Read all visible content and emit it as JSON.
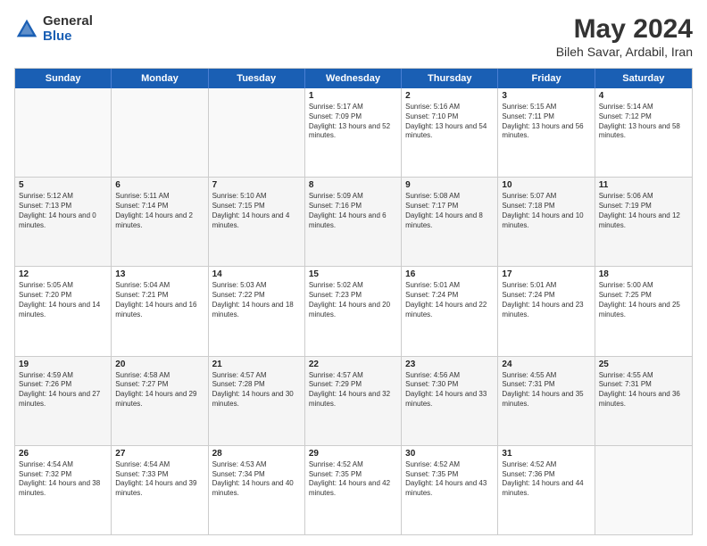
{
  "header": {
    "logo_general": "General",
    "logo_blue": "Blue",
    "title": "May 2024",
    "subtitle": "Bileh Savar, Ardabil, Iran"
  },
  "days_of_week": [
    "Sunday",
    "Monday",
    "Tuesday",
    "Wednesday",
    "Thursday",
    "Friday",
    "Saturday"
  ],
  "weeks": [
    [
      {
        "day": "",
        "sunrise": "",
        "sunset": "",
        "daylight": ""
      },
      {
        "day": "",
        "sunrise": "",
        "sunset": "",
        "daylight": ""
      },
      {
        "day": "",
        "sunrise": "",
        "sunset": "",
        "daylight": ""
      },
      {
        "day": "1",
        "sunrise": "Sunrise: 5:17 AM",
        "sunset": "Sunset: 7:09 PM",
        "daylight": "Daylight: 13 hours and 52 minutes."
      },
      {
        "day": "2",
        "sunrise": "Sunrise: 5:16 AM",
        "sunset": "Sunset: 7:10 PM",
        "daylight": "Daylight: 13 hours and 54 minutes."
      },
      {
        "day": "3",
        "sunrise": "Sunrise: 5:15 AM",
        "sunset": "Sunset: 7:11 PM",
        "daylight": "Daylight: 13 hours and 56 minutes."
      },
      {
        "day": "4",
        "sunrise": "Sunrise: 5:14 AM",
        "sunset": "Sunset: 7:12 PM",
        "daylight": "Daylight: 13 hours and 58 minutes."
      }
    ],
    [
      {
        "day": "5",
        "sunrise": "Sunrise: 5:12 AM",
        "sunset": "Sunset: 7:13 PM",
        "daylight": "Daylight: 14 hours and 0 minutes."
      },
      {
        "day": "6",
        "sunrise": "Sunrise: 5:11 AM",
        "sunset": "Sunset: 7:14 PM",
        "daylight": "Daylight: 14 hours and 2 minutes."
      },
      {
        "day": "7",
        "sunrise": "Sunrise: 5:10 AM",
        "sunset": "Sunset: 7:15 PM",
        "daylight": "Daylight: 14 hours and 4 minutes."
      },
      {
        "day": "8",
        "sunrise": "Sunrise: 5:09 AM",
        "sunset": "Sunset: 7:16 PM",
        "daylight": "Daylight: 14 hours and 6 minutes."
      },
      {
        "day": "9",
        "sunrise": "Sunrise: 5:08 AM",
        "sunset": "Sunset: 7:17 PM",
        "daylight": "Daylight: 14 hours and 8 minutes."
      },
      {
        "day": "10",
        "sunrise": "Sunrise: 5:07 AM",
        "sunset": "Sunset: 7:18 PM",
        "daylight": "Daylight: 14 hours and 10 minutes."
      },
      {
        "day": "11",
        "sunrise": "Sunrise: 5:06 AM",
        "sunset": "Sunset: 7:19 PM",
        "daylight": "Daylight: 14 hours and 12 minutes."
      }
    ],
    [
      {
        "day": "12",
        "sunrise": "Sunrise: 5:05 AM",
        "sunset": "Sunset: 7:20 PM",
        "daylight": "Daylight: 14 hours and 14 minutes."
      },
      {
        "day": "13",
        "sunrise": "Sunrise: 5:04 AM",
        "sunset": "Sunset: 7:21 PM",
        "daylight": "Daylight: 14 hours and 16 minutes."
      },
      {
        "day": "14",
        "sunrise": "Sunrise: 5:03 AM",
        "sunset": "Sunset: 7:22 PM",
        "daylight": "Daylight: 14 hours and 18 minutes."
      },
      {
        "day": "15",
        "sunrise": "Sunrise: 5:02 AM",
        "sunset": "Sunset: 7:23 PM",
        "daylight": "Daylight: 14 hours and 20 minutes."
      },
      {
        "day": "16",
        "sunrise": "Sunrise: 5:01 AM",
        "sunset": "Sunset: 7:24 PM",
        "daylight": "Daylight: 14 hours and 22 minutes."
      },
      {
        "day": "17",
        "sunrise": "Sunrise: 5:01 AM",
        "sunset": "Sunset: 7:24 PM",
        "daylight": "Daylight: 14 hours and 23 minutes."
      },
      {
        "day": "18",
        "sunrise": "Sunrise: 5:00 AM",
        "sunset": "Sunset: 7:25 PM",
        "daylight": "Daylight: 14 hours and 25 minutes."
      }
    ],
    [
      {
        "day": "19",
        "sunrise": "Sunrise: 4:59 AM",
        "sunset": "Sunset: 7:26 PM",
        "daylight": "Daylight: 14 hours and 27 minutes."
      },
      {
        "day": "20",
        "sunrise": "Sunrise: 4:58 AM",
        "sunset": "Sunset: 7:27 PM",
        "daylight": "Daylight: 14 hours and 29 minutes."
      },
      {
        "day": "21",
        "sunrise": "Sunrise: 4:57 AM",
        "sunset": "Sunset: 7:28 PM",
        "daylight": "Daylight: 14 hours and 30 minutes."
      },
      {
        "day": "22",
        "sunrise": "Sunrise: 4:57 AM",
        "sunset": "Sunset: 7:29 PM",
        "daylight": "Daylight: 14 hours and 32 minutes."
      },
      {
        "day": "23",
        "sunrise": "Sunrise: 4:56 AM",
        "sunset": "Sunset: 7:30 PM",
        "daylight": "Daylight: 14 hours and 33 minutes."
      },
      {
        "day": "24",
        "sunrise": "Sunrise: 4:55 AM",
        "sunset": "Sunset: 7:31 PM",
        "daylight": "Daylight: 14 hours and 35 minutes."
      },
      {
        "day": "25",
        "sunrise": "Sunrise: 4:55 AM",
        "sunset": "Sunset: 7:31 PM",
        "daylight": "Daylight: 14 hours and 36 minutes."
      }
    ],
    [
      {
        "day": "26",
        "sunrise": "Sunrise: 4:54 AM",
        "sunset": "Sunset: 7:32 PM",
        "daylight": "Daylight: 14 hours and 38 minutes."
      },
      {
        "day": "27",
        "sunrise": "Sunrise: 4:54 AM",
        "sunset": "Sunset: 7:33 PM",
        "daylight": "Daylight: 14 hours and 39 minutes."
      },
      {
        "day": "28",
        "sunrise": "Sunrise: 4:53 AM",
        "sunset": "Sunset: 7:34 PM",
        "daylight": "Daylight: 14 hours and 40 minutes."
      },
      {
        "day": "29",
        "sunrise": "Sunrise: 4:52 AM",
        "sunset": "Sunset: 7:35 PM",
        "daylight": "Daylight: 14 hours and 42 minutes."
      },
      {
        "day": "30",
        "sunrise": "Sunrise: 4:52 AM",
        "sunset": "Sunset: 7:35 PM",
        "daylight": "Daylight: 14 hours and 43 minutes."
      },
      {
        "day": "31",
        "sunrise": "Sunrise: 4:52 AM",
        "sunset": "Sunset: 7:36 PM",
        "daylight": "Daylight: 14 hours and 44 minutes."
      },
      {
        "day": "",
        "sunrise": "",
        "sunset": "",
        "daylight": ""
      }
    ]
  ]
}
